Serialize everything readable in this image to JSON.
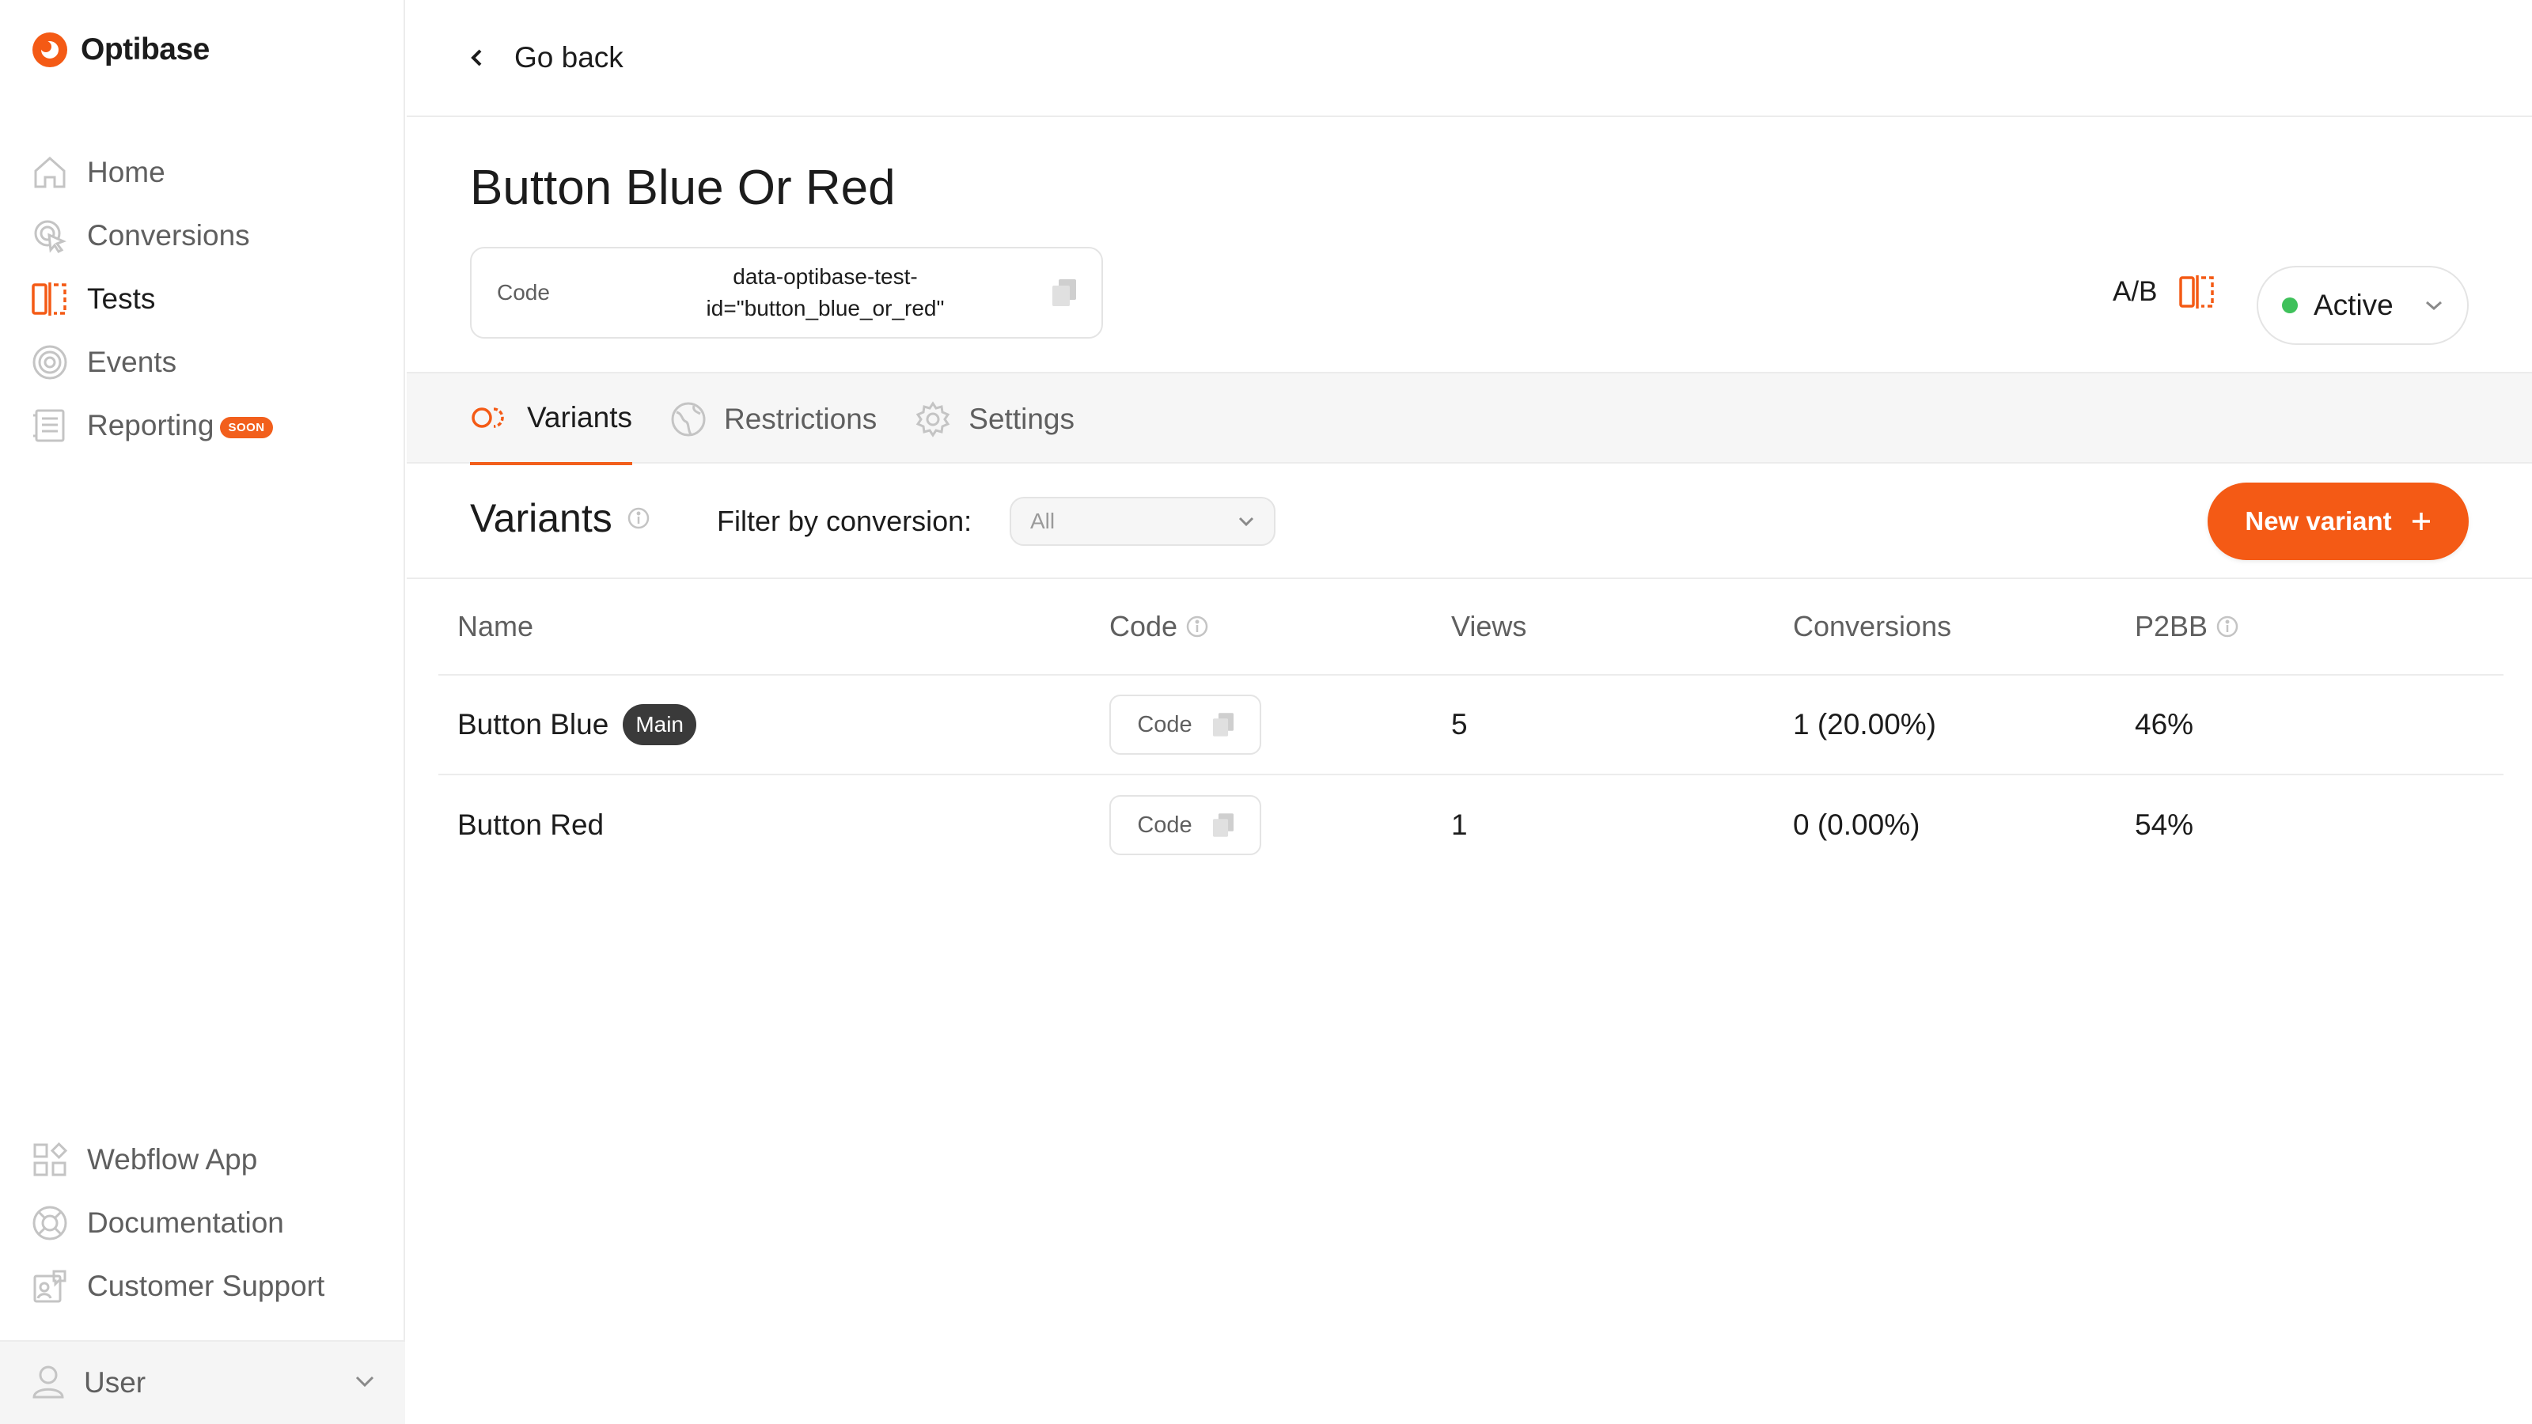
{
  "app": {
    "name": "Optibase"
  },
  "sidebar": {
    "items": [
      {
        "label": "Home",
        "icon": "home-icon"
      },
      {
        "label": "Conversions",
        "icon": "cursor-click-icon"
      },
      {
        "label": "Tests",
        "icon": "ab-split-icon"
      },
      {
        "label": "Events",
        "icon": "target-icon"
      },
      {
        "label": "Reporting",
        "icon": "report-icon",
        "badge": "SOON"
      }
    ],
    "bottom_items": [
      {
        "label": "Webflow App",
        "icon": "apps-grid-icon"
      },
      {
        "label": "Documentation",
        "icon": "lifebuoy-icon"
      },
      {
        "label": "Customer Support",
        "icon": "support-icon"
      }
    ],
    "user_label": "User"
  },
  "topbar": {
    "back_label": "Go back"
  },
  "test": {
    "title": "Button Blue Or Red",
    "code_label": "Code",
    "code_value": "data-optibase-test-id=\"button_blue_or_red\"",
    "type_label": "A/B",
    "status": "Active"
  },
  "tabs": [
    {
      "label": "Variants"
    },
    {
      "label": "Restrictions"
    },
    {
      "label": "Settings"
    }
  ],
  "variants_section": {
    "title": "Variants",
    "filter_label": "Filter by conversion:",
    "filter_value": "All",
    "new_button": "New variant"
  },
  "table": {
    "columns": [
      "Name",
      "Code",
      "Views",
      "Conversions",
      "P2BB"
    ],
    "rows": [
      {
        "name": "Button Blue",
        "badge": "Main",
        "code": "Code",
        "views": "5",
        "conversions": "1 (20.00%)",
        "p2bb": "46%"
      },
      {
        "name": "Button Red",
        "badge": "",
        "code": "Code",
        "views": "1",
        "conversions": "0 (0.00%)",
        "p2bb": "54%"
      }
    ]
  },
  "colors": {
    "accent": "#f45a15",
    "active_dot": "#3fc15b",
    "badge_bg": "#3a3a3a"
  }
}
